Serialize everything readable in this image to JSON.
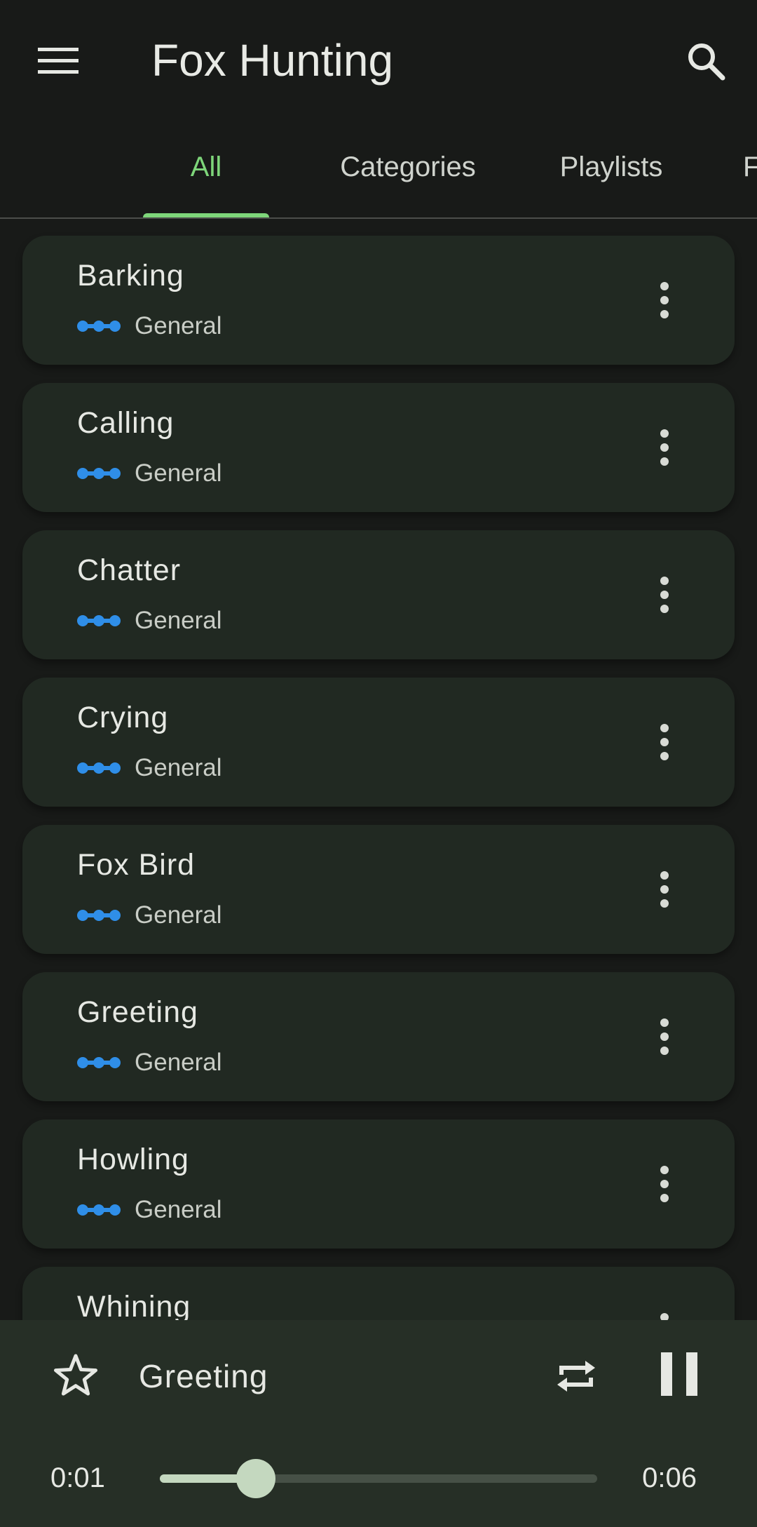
{
  "app_bar": {
    "title": "Fox Hunting",
    "menu_icon": "menu-icon",
    "search_icon": "search-icon"
  },
  "tabs": [
    {
      "label": "All",
      "active": true
    },
    {
      "label": "Categories",
      "active": false
    },
    {
      "label": "Playlists",
      "active": false
    },
    {
      "label": "F",
      "active": false
    }
  ],
  "sounds": [
    {
      "title": "Barking",
      "category": "General"
    },
    {
      "title": "Calling",
      "category": "General"
    },
    {
      "title": "Chatter",
      "category": "General"
    },
    {
      "title": "Crying",
      "category": "General"
    },
    {
      "title": "Fox Bird",
      "category": "General"
    },
    {
      "title": "Greeting",
      "category": "General"
    },
    {
      "title": "Howling",
      "category": "General"
    },
    {
      "title": "Whining",
      "category": ""
    }
  ],
  "player": {
    "title": "Greeting",
    "current_time": "0:01",
    "duration": "0:06",
    "progress": 0.22,
    "star_icon": "star-outline-icon",
    "repeat_icon": "repeat-icon",
    "pause_icon": "pause-icon"
  },
  "colors": {
    "background": "#181a18",
    "card": "#212922",
    "accent": "#7ed67a",
    "category_icon": "#2f8ee8",
    "player": "#262f26",
    "slider": "#c4d8bf"
  }
}
